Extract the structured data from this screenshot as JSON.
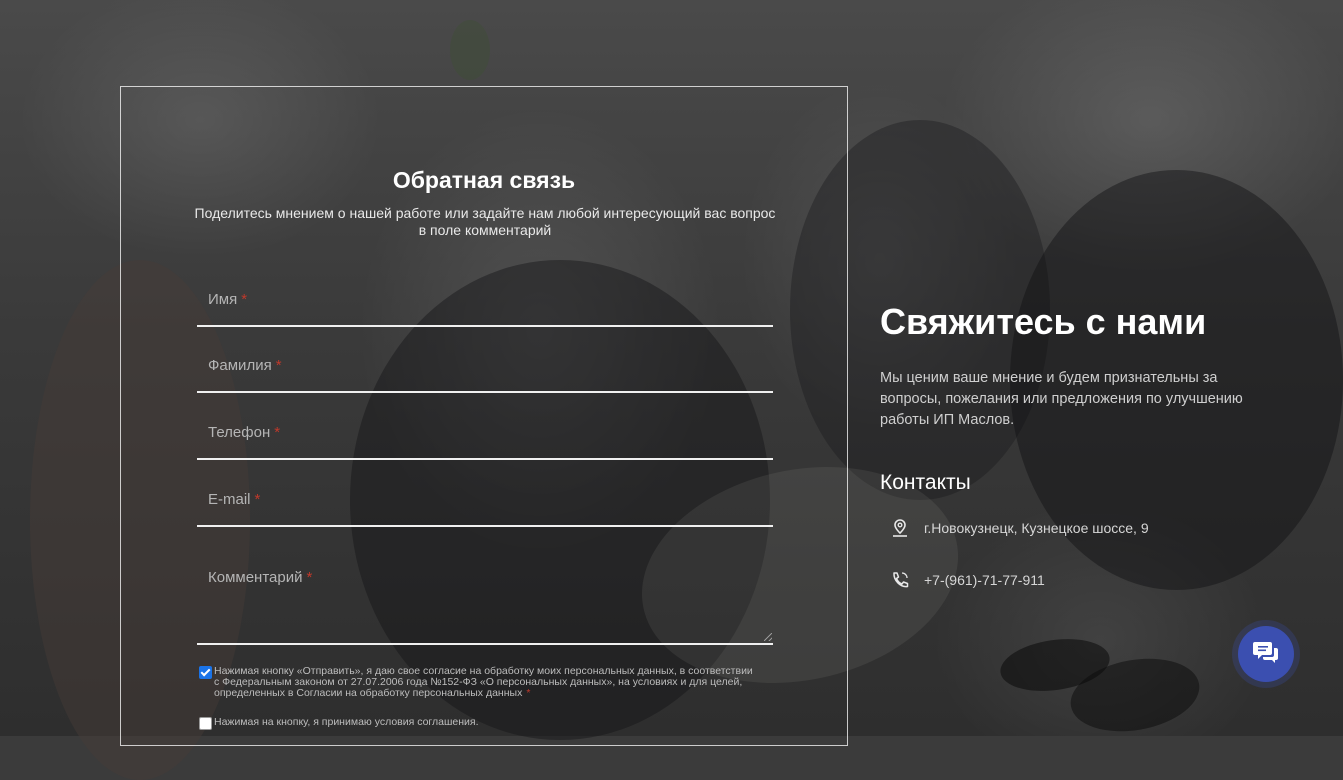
{
  "form": {
    "title": "Обратная связь",
    "subtitle": "Поделитесь мнением о нашей работе или задайте нам любой интересующий вас вопрос в поле комментарий",
    "fields": [
      {
        "label": "Имя",
        "required_mark": "*"
      },
      {
        "label": "Фамилия",
        "required_mark": "*"
      },
      {
        "label": "Телефон",
        "required_mark": "*"
      },
      {
        "label": "E-mail",
        "required_mark": "*"
      }
    ],
    "comment": {
      "label": "Комментарий",
      "required_mark": "*"
    },
    "consent_personal_data": {
      "checked": true,
      "text": "Нажимая кнопку «Отправить», я даю свое согласие на обработку моих персональных данных, в соответствии с Федеральным законом от 27.07.2006 года №152-ФЗ «О персональных данных», на условиях и для целей, определенных в Согласии на обработку персональных данных",
      "required_mark": "*"
    },
    "consent_agreement": {
      "checked": false,
      "text": "Нажимая на кнопку, я принимаю условия соглашения."
    }
  },
  "contact": {
    "title": "Свяжитесь с нами",
    "description": "Мы ценим ваше мнение и будем признательны за вопросы, пожелания или предложения по улучшению работы ИП Маслов.",
    "contacts_heading": "Контакты",
    "address": {
      "icon": "location-pin-icon",
      "text": "г.Новокузнецк, Кузнецкое шоссе, 9"
    },
    "phone": {
      "icon": "phone-icon",
      "text": "+7-(961)-71-77-911"
    }
  },
  "chat_widget": {
    "icon": "chat-bubbles-icon",
    "color": "#3b4fb0"
  }
}
